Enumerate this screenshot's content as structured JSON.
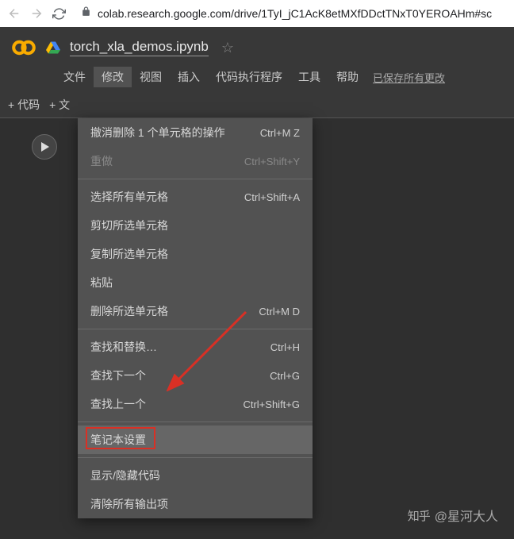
{
  "browser": {
    "url": "colab.research.google.com/drive/1TyI_jC1AcK8etMXfDDctTNxT0YEROAHm#sc"
  },
  "doc": {
    "title": "torch_xla_demos.ipynb"
  },
  "menus": {
    "file": "文件",
    "edit": "修改",
    "view": "视图",
    "insert": "插入",
    "runtime": "代码执行程序",
    "tools": "工具",
    "help": "帮助",
    "saved": "已保存所有更改"
  },
  "toolbar": {
    "code": "+ 代码",
    "text": "+ 文"
  },
  "dropdown": {
    "undo": {
      "label": "撤消删除 1 个单元格的操作",
      "sc": "Ctrl+M Z"
    },
    "redo": {
      "label": "重做",
      "sc": "Ctrl+Shift+Y"
    },
    "selectAll": {
      "label": "选择所有单元格",
      "sc": "Ctrl+Shift+A"
    },
    "cut": {
      "label": "剪切所选单元格",
      "sc": ""
    },
    "copy": {
      "label": "复制所选单元格",
      "sc": ""
    },
    "paste": {
      "label": "粘贴",
      "sc": ""
    },
    "delete": {
      "label": "删除所选单元格",
      "sc": "Ctrl+M D"
    },
    "findReplace": {
      "label": "查找和替换…",
      "sc": "Ctrl+H"
    },
    "findNext": {
      "label": "查找下一个",
      "sc": "Ctrl+G"
    },
    "findPrev": {
      "label": "查找上一个",
      "sc": "Ctrl+Shift+G"
    },
    "notebookSettings": {
      "label": "笔记本设置",
      "sc": ""
    },
    "toggleCode": {
      "label": "显示/隐藏代码",
      "sc": ""
    },
    "clearOutputs": {
      "label": "清除所有输出项",
      "sc": ""
    }
  },
  "watermark": {
    "site": "知乎",
    "author": "@星河大人"
  }
}
